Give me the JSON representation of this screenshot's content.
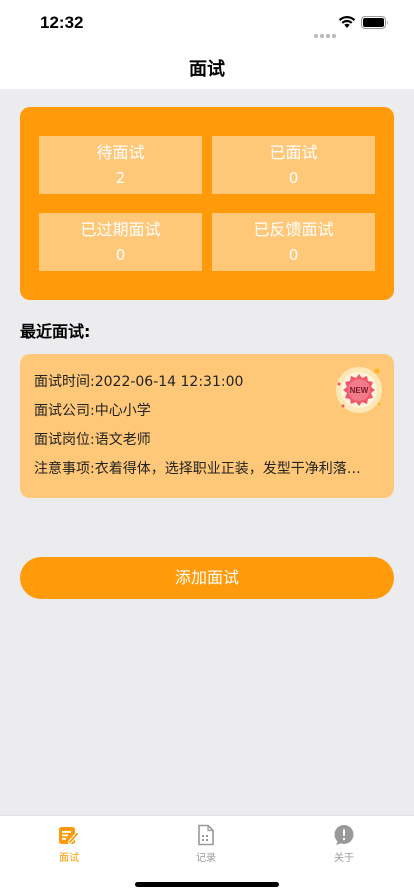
{
  "status_bar": {
    "time": "12:32"
  },
  "nav": {
    "title": "面试"
  },
  "stats": [
    {
      "label": "待面试",
      "value": "2"
    },
    {
      "label": "已面试",
      "value": "0"
    },
    {
      "label": "已过期面试",
      "value": "0"
    },
    {
      "label": "已反馈面试",
      "value": "0"
    }
  ],
  "recent": {
    "section_title": "最近面试:",
    "time": "面试时间:2022-06-14 12:31:00",
    "company": "面试公司:中心小学",
    "position": "面试岗位:语文老师",
    "notes": "注意事项:衣着得体，选择职业正装，发型干净利落，...",
    "badge": "NEW"
  },
  "actions": {
    "add_label": "添加面试"
  },
  "tabs": [
    {
      "label": "面试",
      "icon": "interview-icon",
      "active": true
    },
    {
      "label": "记录",
      "icon": "records-icon",
      "active": false
    },
    {
      "label": "关于",
      "icon": "about-icon",
      "active": false
    }
  ],
  "colors": {
    "accent": "#ff9a0a",
    "cell": "#ffc878",
    "background": "#ececef",
    "inactive_tab": "#999999"
  }
}
